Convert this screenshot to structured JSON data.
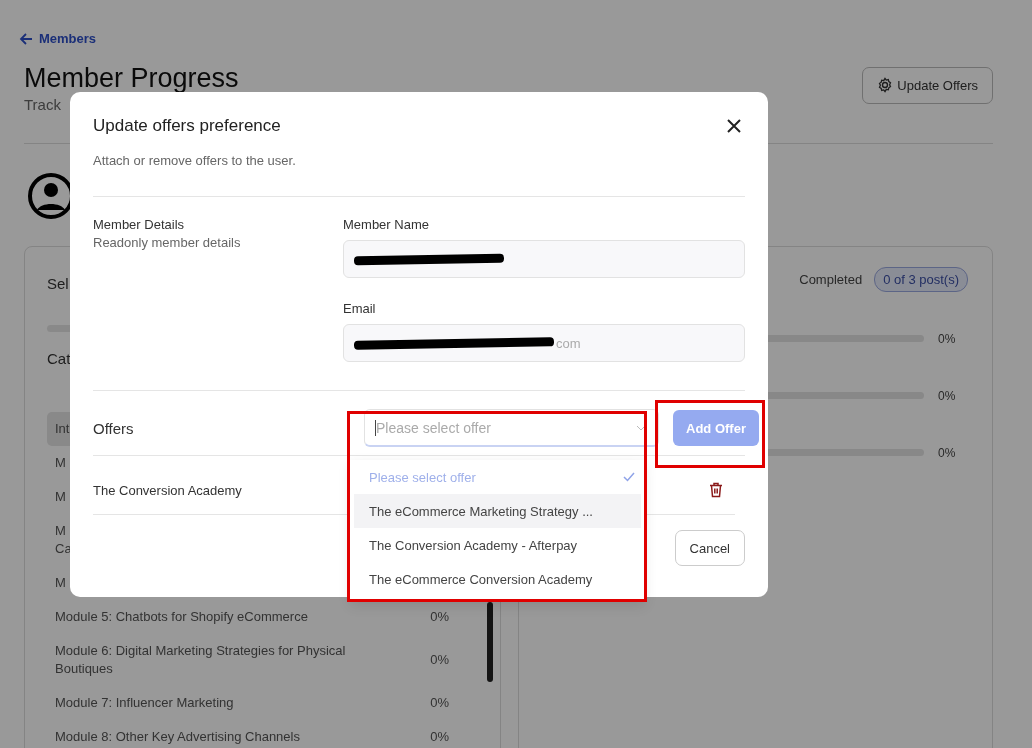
{
  "back_link": {
    "label": "Members"
  },
  "page": {
    "title": "Member Progress",
    "subtitle": "Track"
  },
  "update_offers_button": {
    "label": "Update Offers"
  },
  "left_card": {
    "heading": "Sel",
    "progress": {
      "level": 0
    },
    "section": "Cat",
    "items": [
      {
        "lines": [
          "Int"
        ],
        "selected": true
      },
      {
        "lines": [
          "M"
        ],
        "selected": false
      },
      {
        "lines": [
          "M"
        ],
        "selected": false
      },
      {
        "lines": [
          "M",
          "Ca"
        ],
        "selected": false
      },
      {
        "lines": [
          "M"
        ],
        "selected": false
      },
      {
        "lines": [
          "Module 5: Chatbots for Shopify eCommerce"
        ],
        "percent": "0%",
        "selected": false
      },
      {
        "lines": [
          "Module 6: Digital Marketing Strategies for Physical",
          "Boutiques"
        ],
        "percent": "0%",
        "selected": false
      },
      {
        "lines": [
          "Module 7: Influencer Marketing"
        ],
        "percent": "0%",
        "selected": false
      },
      {
        "lines": [
          "Module 8: Other Key Advertising Channels"
        ],
        "percent": "0%",
        "selected": false
      }
    ]
  },
  "right_card": {
    "status_label": "Completed",
    "badge": "0 of 3 post(s)",
    "bars": [
      {
        "level": 0,
        "reading": "0%"
      },
      {
        "level": 0,
        "reading": "0%"
      },
      {
        "level": 0,
        "reading": "0%"
      }
    ]
  },
  "modal": {
    "title": "Update offers preference",
    "subtitle": "Attach or remove offers to the user.",
    "section_title": "Member Details",
    "section_hint": "Readonly member details",
    "fields": [
      {
        "label": "Member Name",
        "redacted": true
      },
      {
        "label": "Email",
        "redacted": true,
        "value": "com"
      }
    ],
    "offers": {
      "label": "Offers",
      "placeholder": "Please select offer",
      "open": true,
      "options": [
        {
          "label": "Please select offer",
          "selected": true,
          "hovered": false
        },
        {
          "label": "The eCommerce Marketing Strategy ...",
          "selected": false,
          "hovered": true
        },
        {
          "label": "The Conversion Academy - Afterpay",
          "selected": false,
          "hovered": false
        },
        {
          "label": "The eCommerce Conversion Academy",
          "selected": false,
          "hovered": false
        }
      ]
    },
    "add_button": {
      "label": "Add Offer",
      "disabled": true
    },
    "attached_offers": [
      {
        "name": "The Conversion Academy"
      }
    ],
    "cancel_button": {
      "label": "Cancel"
    }
  }
}
